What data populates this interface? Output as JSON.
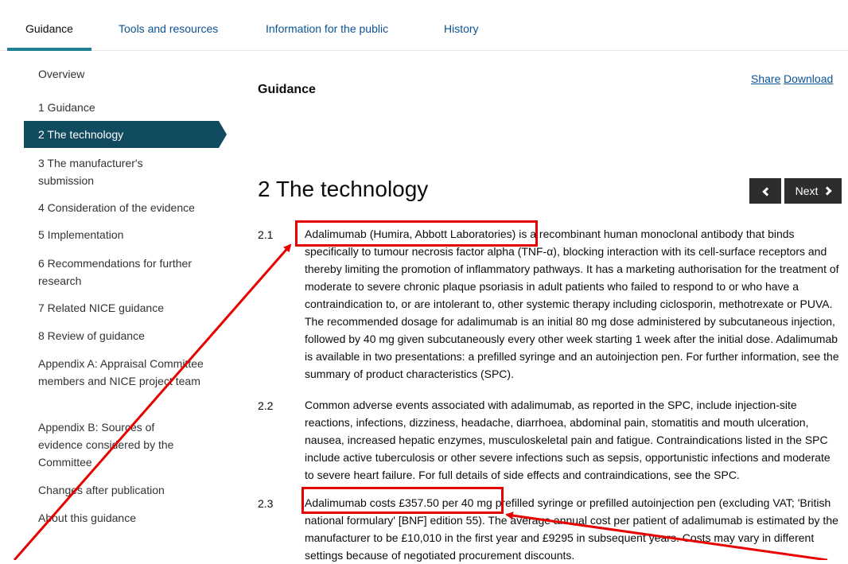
{
  "tabs": [
    {
      "label": "Guidance"
    },
    {
      "label": "Tools and resources"
    },
    {
      "label": "Information for the public"
    },
    {
      "label": "History"
    }
  ],
  "sidebar": {
    "items": [
      {
        "label": "Overview"
      },
      {
        "label": "1 Guidance"
      },
      {
        "label": "2 The technology"
      },
      {
        "label": "3 The manufacturer's submission"
      },
      {
        "label": "4 Consideration of the evidence"
      },
      {
        "label": "5 Implementation"
      },
      {
        "label": "6 Recommendations for further research"
      },
      {
        "label": "7 Related NICE guidance"
      },
      {
        "label": "8 Review of guidance"
      },
      {
        "label": "Appendix A: Appraisal Committee members and NICE project team"
      },
      {
        "label": "Appendix B: Sources of evidence considered by the Committee"
      },
      {
        "label": "Changes after publication"
      },
      {
        "label": "About this guidance"
      }
    ]
  },
  "header": {
    "section_label": "Guidance",
    "share": "Share",
    "download": "Download"
  },
  "main": {
    "title": "2 The technology",
    "next_label": "Next",
    "paragraphs": [
      {
        "num": "2.1",
        "text": "Adalimumab (Humira, Abbott Laboratories) is a recombinant human monoclonal antibody that binds specifically to tumour necrosis factor alpha (TNF-α), blocking interaction with its cell-surface receptors and thereby limiting the promotion of inflammatory pathways. It has a marketing authorisation for the treatment of moderate to severe chronic plaque psoriasis in adult patients who failed to respond to or who have a contraindication to, or are intolerant to, other systemic therapy including ciclosporin, methotrexate or PUVA. The recommended dosage for adalimumab is an initial 80 mg dose administered by subcutaneous injection, followed by 40 mg given subcutaneously every other week starting 1 week after the initial dose. Adalimumab is available in two presentations: a prefilled syringe and an autoinjection pen. For further information, see the summary of product characteristics (SPC)."
      },
      {
        "num": "2.2",
        "text": "Common adverse events associated with adalimumab, as reported in the SPC, include injection-site reactions, infections, dizziness, headache, diarrhoea, abdominal pain, stomatitis and mouth ulceration, nausea, increased hepatic enzymes, musculoskeletal pain and fatigue. Contraindications listed in the SPC include active tuberculosis or other severe infections such as sepsis, opportunistic infections and moderate to severe heart failure. For full details of side effects and contraindications, see the SPC."
      },
      {
        "num": "2.3",
        "text": "Adalimumab costs £357.50 per 40 mg prefilled syringe or prefilled autoinjection pen (excluding VAT; 'British national formulary' [BNF] edition 55). The average annual cost per patient of adalimumab is estimated by the manufacturer to be £10,010 in the first year and £9295 in subsequent years. Costs may vary in different settings because of negotiated procurement discounts."
      }
    ]
  },
  "colors": {
    "accent": "#114b5f",
    "link": "#0b5394",
    "annotation": "#e60000"
  }
}
